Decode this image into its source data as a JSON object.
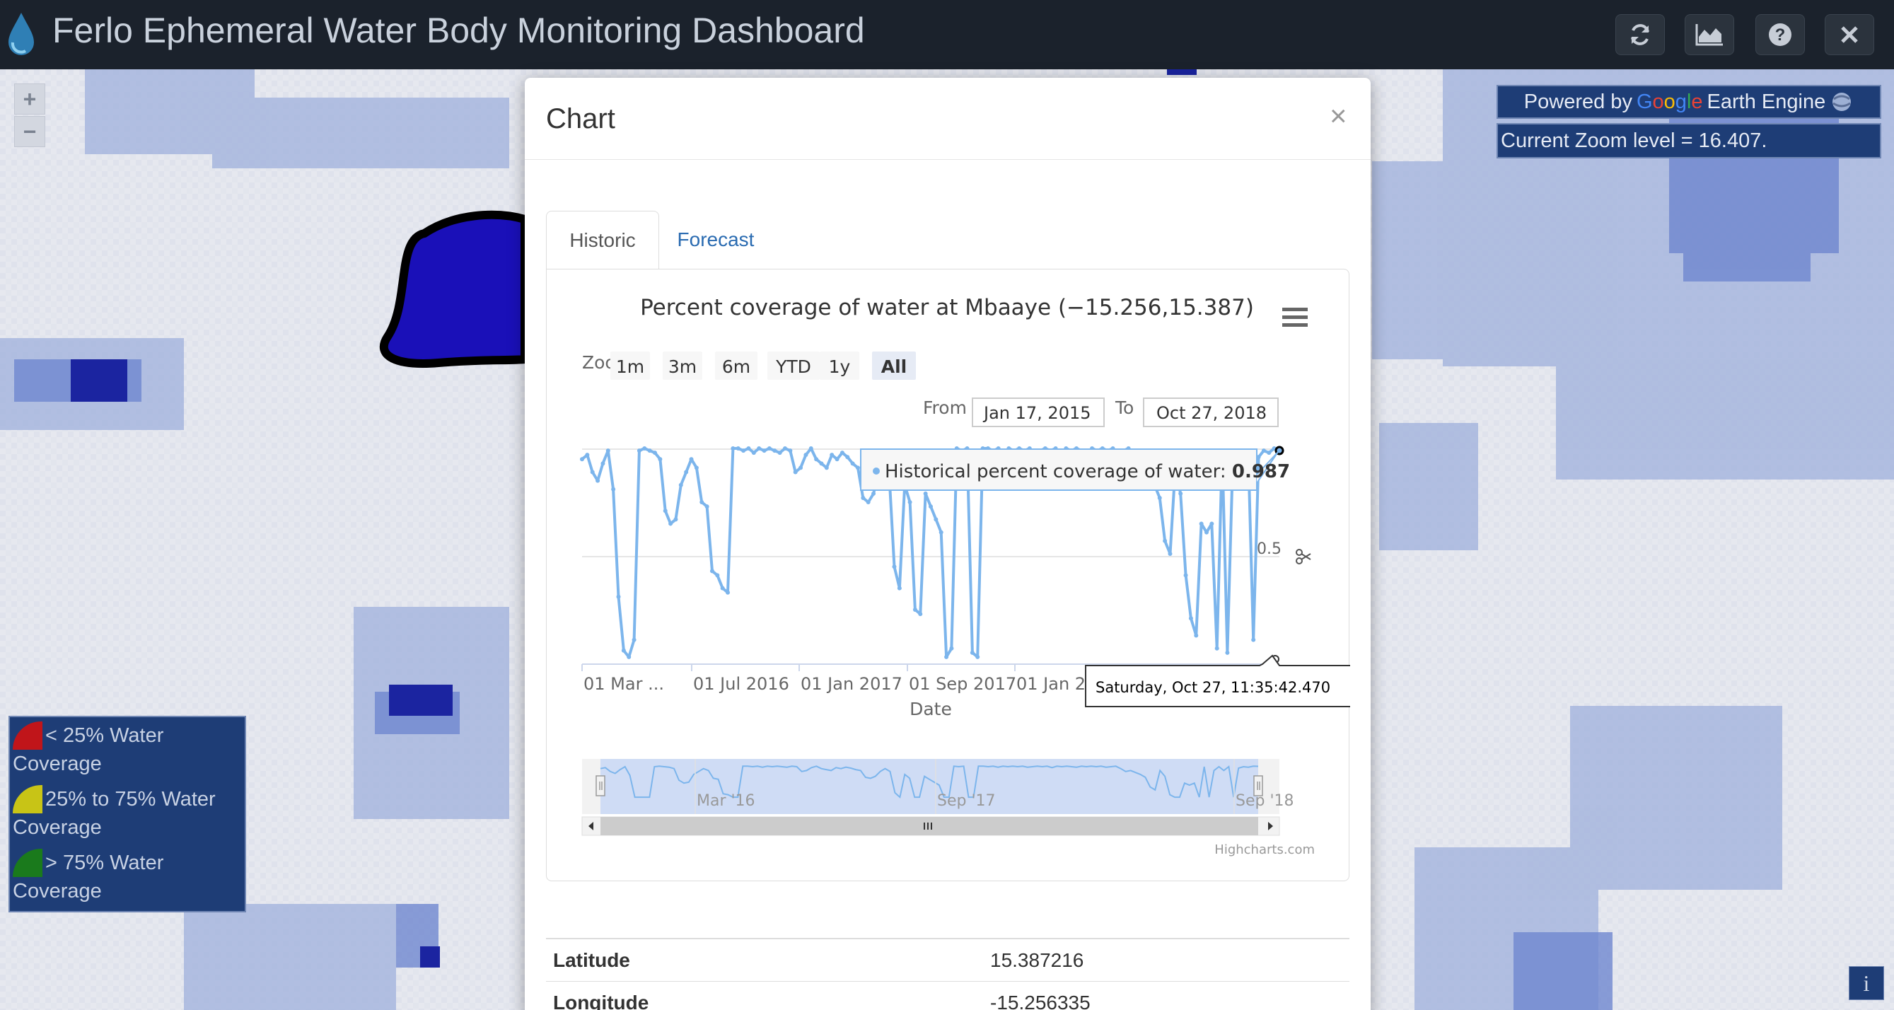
{
  "app": {
    "title": "Ferlo Ephemeral Water Body Monitoring Dashboard",
    "header_buttons": [
      "refresh-icon",
      "area-chart-icon",
      "help-icon",
      "close-icon"
    ]
  },
  "map": {
    "zoom_in": "+",
    "zoom_out": "−",
    "gee": {
      "prefix": "Powered by",
      "google": "Google",
      "suffix": "Earth Engine"
    },
    "zoom_level_text": "Current Zoom level = 16.407.",
    "info_button": "i"
  },
  "legend": {
    "items": [
      {
        "label": "< 25% Water Coverage",
        "color": "#c0151a"
      },
      {
        "label": "25% to 75% Water Coverage",
        "color": "#c8c416"
      },
      {
        "label": "> 75% Water Coverage",
        "color": "#1a7a1c"
      }
    ]
  },
  "modal": {
    "title": "Chart",
    "close": "×",
    "tabs": [
      {
        "label": "Historic",
        "active": true
      },
      {
        "label": "Forecast",
        "active": false
      }
    ],
    "info": [
      {
        "key": "Latitude",
        "value": "15.387216"
      },
      {
        "key": "Longitude",
        "value": "-15.256335"
      }
    ]
  },
  "chart_data": {
    "type": "line",
    "title": "Percent coverage of water at Mbaaye (−15.256,15.387)",
    "xlabel": "Date",
    "ylabel": "",
    "zoom_label": "Zoom",
    "zoom_buttons": [
      "1m",
      "3m",
      "6m",
      "YTD",
      "1y",
      "All"
    ],
    "zoom_selected": "All",
    "from_label": "From",
    "from_value": "Jan 17, 2015",
    "to_label": "To",
    "to_value": "Oct 27, 2018",
    "x_ticks": [
      "01 Mar ...",
      "01 Jul 2016",
      "01 Jan 2017",
      "01 Sep 2017",
      "01 Jan 20"
    ],
    "y_ticks": [
      "0.5"
    ],
    "ylim": [
      0,
      1
    ],
    "navigator_ticks": [
      "Mar '16",
      "Sep '17",
      "Sep '18"
    ],
    "tooltip": {
      "series": "Historical percent coverage of water",
      "value": "0.987"
    },
    "crosshair_label": "Saturday, Oct 27, 11:35:42.470",
    "credits": "Highcharts.com",
    "color": "#7cb5ec",
    "series": [
      {
        "name": "Historical percent coverage of water",
        "values": [
          0.94,
          0.96,
          0.88,
          0.84,
          0.92,
          0.98,
          0.8,
          0.3,
          0.05,
          0.02,
          0.1,
          0.98,
          0.99,
          0.98,
          0.97,
          0.94,
          0.7,
          0.64,
          0.66,
          0.82,
          0.88,
          0.94,
          0.9,
          0.74,
          0.72,
          0.42,
          0.4,
          0.34,
          0.32,
          0.99,
          0.99,
          0.98,
          0.99,
          0.97,
          0.99,
          0.98,
          0.99,
          0.98,
          0.97,
          0.99,
          0.98,
          0.88,
          0.9,
          0.96,
          0.99,
          0.94,
          0.92,
          0.9,
          0.96,
          0.94,
          0.97,
          0.95,
          0.92,
          0.9,
          0.76,
          0.74,
          0.78,
          0.88,
          0.94,
          0.88,
          0.44,
          0.34,
          0.82,
          0.74,
          0.24,
          0.22,
          0.78,
          0.72,
          0.66,
          0.6,
          0.02,
          0.06,
          0.99,
          0.98,
          0.99,
          0.04,
          0.02,
          0.99,
          0.99,
          0.98,
          0.99,
          0.97,
          0.99,
          0.98,
          0.99,
          0.98,
          0.99,
          0.97,
          0.98,
          0.99,
          0.98,
          0.99,
          0.96,
          0.99,
          0.98,
          0.99,
          0.98,
          0.97,
          0.99,
          0.98,
          0.99,
          0.98,
          0.99,
          0.97,
          0.98,
          0.99,
          0.94,
          0.88,
          0.9,
          0.86,
          0.82,
          0.76,
          0.56,
          0.5,
          0.9,
          0.78,
          0.4,
          0.2,
          0.12,
          0.64,
          0.6,
          0.64,
          0.06,
          0.98,
          0.04,
          0.9,
          0.98,
          0.9,
          0.98,
          0.1,
          0.95,
          0.98,
          0.97,
          0.99,
          0.987
        ]
      }
    ]
  }
}
